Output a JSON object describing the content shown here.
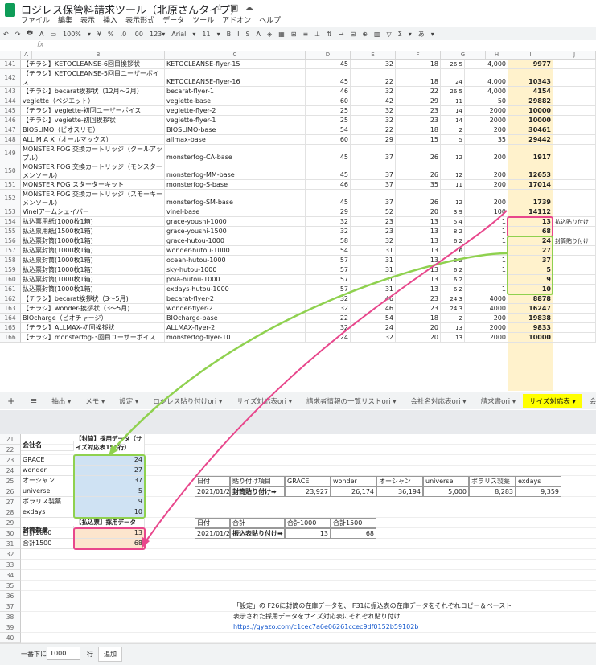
{
  "doc_title": "ロジレス保管料請求ツール（北原さんタイプ）",
  "title_icons": [
    "star-icon",
    "folder-icon",
    "cloud-icon"
  ],
  "menu": [
    "ファイル",
    "編集",
    "表示",
    "挿入",
    "表示形式",
    "データ",
    "ツール",
    "アドオン",
    "ヘルプ"
  ],
  "toolbar": [
    "↶",
    "↷",
    "🖶",
    "A",
    "▭",
    "100%",
    "▾",
    "¥",
    "%",
    ".0",
    ".00",
    "123▾",
    "Arial",
    "▾",
    "11",
    "▾",
    "B",
    "I",
    "S",
    "A",
    "◈",
    "▦",
    "⊞",
    "≡",
    "⊥",
    "⇅",
    "↦",
    "⊟",
    "⊕",
    "▥",
    "▽",
    "Σ",
    "▾",
    "あ",
    "▾"
  ],
  "formula_label": "fx",
  "col_headers": [
    "A",
    "B",
    "C",
    "D",
    "E",
    "F",
    "G",
    "H",
    "I",
    "J"
  ],
  "top_rows": [
    {
      "n": "141",
      "b": "【チラシ】KETOCLEANSE-6回目挨拶状",
      "c": "KETOCLEANSE-flyer-15",
      "d": "45",
      "e": "32",
      "f": "18",
      "g": "26.5",
      "h": "4,000",
      "i": "9977",
      "j": "",
      "h2": false
    },
    {
      "n": "142",
      "b": "【チラシ】KETOCLEANSE-5回目ユーザーボイス",
      "c": "KETOCLEANSE-flyer-16",
      "d": "45",
      "e": "22",
      "f": "18",
      "g": "24",
      "h": "4,000",
      "i": "10343",
      "j": "",
      "h2": true
    },
    {
      "n": "143",
      "b": "【チラシ】becarat挨拶状（12月〜2月）",
      "c": "becarat-flyer-1",
      "d": "46",
      "e": "32",
      "f": "22",
      "g": "26.5",
      "h": "4,000",
      "i": "4154",
      "j": "",
      "h2": false
    },
    {
      "n": "144",
      "b": "vegiette（ベジエット）",
      "c": "vegiette-base",
      "d": "60",
      "e": "42",
      "f": "29",
      "g": "11",
      "h": "50",
      "i": "29882",
      "j": "",
      "h2": false
    },
    {
      "n": "145",
      "b": "【チラシ】vegiette-初回ユーザーボイス",
      "c": "vegiette-flyer-2",
      "d": "25",
      "e": "32",
      "f": "23",
      "g": "14",
      "h": "2000",
      "i": "10000",
      "j": "",
      "h2": false
    },
    {
      "n": "146",
      "b": "【チラシ】vegiette-初回挨拶状",
      "c": "vegiette-flyer-1",
      "d": "25",
      "e": "32",
      "f": "23",
      "g": "14",
      "h": "2000",
      "i": "10000",
      "j": "",
      "h2": false
    },
    {
      "n": "147",
      "b": "BIOSLIMO（ビオスリモ）",
      "c": "BIOSLIMO-base",
      "d": "54",
      "e": "22",
      "f": "18",
      "g": "2",
      "h": "200",
      "i": "30461",
      "j": "",
      "h2": false
    },
    {
      "n": "148",
      "b": "ALL M A X（オールマックス）",
      "c": "allmax-base",
      "d": "60",
      "e": "29",
      "f": "15",
      "g": "5",
      "h": "35",
      "i": "29442",
      "j": "",
      "h2": false
    },
    {
      "n": "149",
      "b": "MONSTER FOG 交換カートリッジ（クールアップル）",
      "c": "monsterfog-CA-base",
      "d": "45",
      "e": "37",
      "f": "26",
      "g": "12",
      "h": "200",
      "i": "1917",
      "j": "",
      "h2": true
    },
    {
      "n": "150",
      "b": "MONSTER FOG 交換カートリッジ（モンスターメンソール）",
      "c": "monsterfog-MM-base",
      "d": "45",
      "e": "37",
      "f": "26",
      "g": "12",
      "h": "200",
      "i": "12653",
      "j": "",
      "h2": true
    },
    {
      "n": "151",
      "b": "MONSTER FOG スターターキット",
      "c": "monsterfog-S-base",
      "d": "46",
      "e": "37",
      "f": "35",
      "g": "11",
      "h": "200",
      "i": "17014",
      "j": "",
      "h2": false
    },
    {
      "n": "152",
      "b": "MONSTER FOG 交換カートリッジ（スモーキーメンソール）",
      "c": "monsterfog-SM-base",
      "d": "45",
      "e": "37",
      "f": "26",
      "g": "12",
      "h": "200",
      "i": "1739",
      "j": "",
      "h2": true
    },
    {
      "n": "153",
      "b": "Vinelアームシェイバー",
      "c": "vinel-base",
      "d": "29",
      "e": "52",
      "f": "20",
      "g": "3.9",
      "h": "100",
      "i": "14112",
      "j": "",
      "h2": false
    },
    {
      "n": "154",
      "b": "払込票用紙(1000枚1箱)",
      "c": "grace-youshi-1000",
      "d": "32",
      "e": "23",
      "f": "13",
      "g": "5.4",
      "h": "1",
      "i": "13",
      "j": "払込貼り付け",
      "h2": false
    },
    {
      "n": "155",
      "b": "払込票用紙(1500枚1箱)",
      "c": "grace-youshi-1500",
      "d": "32",
      "e": "23",
      "f": "13",
      "g": "8.2",
      "h": "1",
      "i": "68",
      "j": "",
      "h2": false
    },
    {
      "n": "156",
      "b": "払込票封筒(1000枚1箱)",
      "c": "grace-hutou-1000",
      "d": "58",
      "e": "32",
      "f": "13",
      "g": "6.2",
      "h": "1",
      "i": "24",
      "j": "封筒貼り付け",
      "h2": false
    },
    {
      "n": "157",
      "b": "払込票封筒(1000枚1箱)",
      "c": "wonder-hutou-1000",
      "d": "54",
      "e": "31",
      "f": "13",
      "g": "6",
      "h": "1",
      "i": "27",
      "j": "",
      "h2": false
    },
    {
      "n": "158",
      "b": "払込票封筒(1000枚1箱)",
      "c": "ocean-hutou-1000",
      "d": "57",
      "e": "31",
      "f": "13",
      "g": "6.2",
      "h": "1",
      "i": "37",
      "j": "",
      "h2": false
    },
    {
      "n": "159",
      "b": "払込票封筒(1000枚1箱)",
      "c": "sky-hutou-1000",
      "d": "57",
      "e": "31",
      "f": "13",
      "g": "6.2",
      "h": "1",
      "i": "5",
      "j": "",
      "h2": false
    },
    {
      "n": "160",
      "b": "払込票封筒(1000枚1箱)",
      "c": "pola-hutou-1000",
      "d": "57",
      "e": "31",
      "f": "13",
      "g": "6.2",
      "h": "1",
      "i": "9",
      "j": "",
      "h2": false
    },
    {
      "n": "161",
      "b": "払込票封筒(1000枚1箱)",
      "c": "exdays-hutou-1000",
      "d": "57",
      "e": "31",
      "f": "13",
      "g": "6.2",
      "h": "1",
      "i": "10",
      "j": "",
      "h2": false
    },
    {
      "n": "162",
      "b": "【チラシ】becarat挨拶状（3〜5月)",
      "c": "becarat-flyer-2",
      "d": "32",
      "e": "46",
      "f": "23",
      "g": "24.3",
      "h": "4000",
      "i": "8878",
      "j": "",
      "h2": false
    },
    {
      "n": "163",
      "b": "【チラシ】wonder-挨拶状（3〜5月)",
      "c": "wonder-flyer-2",
      "d": "32",
      "e": "46",
      "f": "23",
      "g": "24.3",
      "h": "4000",
      "i": "16247",
      "j": "",
      "h2": false
    },
    {
      "n": "164",
      "b": "BIOcharge（ビオチャージ）",
      "c": "BIOcharge-base",
      "d": "22",
      "e": "54",
      "f": "18",
      "g": "2",
      "h": "200",
      "i": "19838",
      "j": "",
      "h2": false
    },
    {
      "n": "165",
      "b": "【チラシ】ALLMAX-初回挨拶状",
      "c": "ALLMAX-flyer-2",
      "d": "32",
      "e": "24",
      "f": "20",
      "g": "13",
      "h": "2000",
      "i": "9833",
      "j": "",
      "h2": false
    },
    {
      "n": "166",
      "b": "【チラシ】monsterfog-3回目ユーザーボイス",
      "c": "monsterfog-flyer-10",
      "d": "24",
      "e": "32",
      "f": "20",
      "g": "13",
      "h": "2000",
      "i": "10000",
      "j": "",
      "h2": false
    }
  ],
  "tabs": {
    "add": "+",
    "list": "≡",
    "items": [
      "抽出 ▾",
      "メモ ▾",
      "設定 ▾",
      "ロジレス貼り付けori ▾",
      "サイズ対応表ori ▾",
      "請求者情報の一覧リストori ▾",
      "会社名対応表ori ▾",
      "請求書ori ▾"
    ],
    "active": "サイズ対応表 ▾",
    "next": "会社名対応"
  },
  "bottom": {
    "rows": [
      "21",
      "22",
      "23",
      "24",
      "25",
      "26",
      "27",
      "28",
      "29",
      "30",
      "31",
      "32",
      "33",
      "34",
      "35",
      "36",
      "37",
      "38",
      "39",
      "40"
    ],
    "company_header": "会社名",
    "env_header": "【封筒】採用データ（サイズ対応表156行）",
    "envelopes": [
      {
        "name": "GRACE",
        "val": "24"
      },
      {
        "name": "wonder",
        "val": "27"
      },
      {
        "name": "オーシャン",
        "val": "37"
      },
      {
        "name": "universe",
        "val": "5"
      },
      {
        "name": "ポラリス製薬",
        "val": "9"
      },
      {
        "name": "exdays",
        "val": "10"
      }
    ],
    "qty_header": "封筒数量",
    "pay_header": "【払込票】採用データ（サイズ対応表154行）",
    "payments": [
      {
        "name": "合計1000",
        "val": "13"
      },
      {
        "name": "合計1500",
        "val": "68"
      }
    ],
    "table1_head": [
      "日付",
      "貼り付け項目",
      "GRACE",
      "wonder",
      "オーシャン",
      "universe",
      "ポラリス製薬",
      "exdays"
    ],
    "table1_row": [
      "2021/01/25",
      "封筒貼り付け➡",
      "23,927",
      "26,174",
      "36,194",
      "5,000",
      "8,283",
      "9,359"
    ],
    "table2_head": [
      "日付",
      "合計",
      "合計1000",
      "合計1500"
    ],
    "table2_row": [
      "2021/01/25",
      "振込表貼り付け➡",
      "13",
      "68"
    ],
    "note1": "「設定」の F26に封筒の在庫データを、 F31に振込表の在庫データをそれぞれコピー＆ペースト",
    "note2": "表示された採用データをサイズ対応表にそれぞれ貼り付け",
    "link": "https://gyazo.com/c1cec7a6e06261ccec9df0152b59102b",
    "footer_label": "一番下に",
    "footer_value": "1000",
    "footer_unit": "行",
    "footer_button": "追加"
  }
}
